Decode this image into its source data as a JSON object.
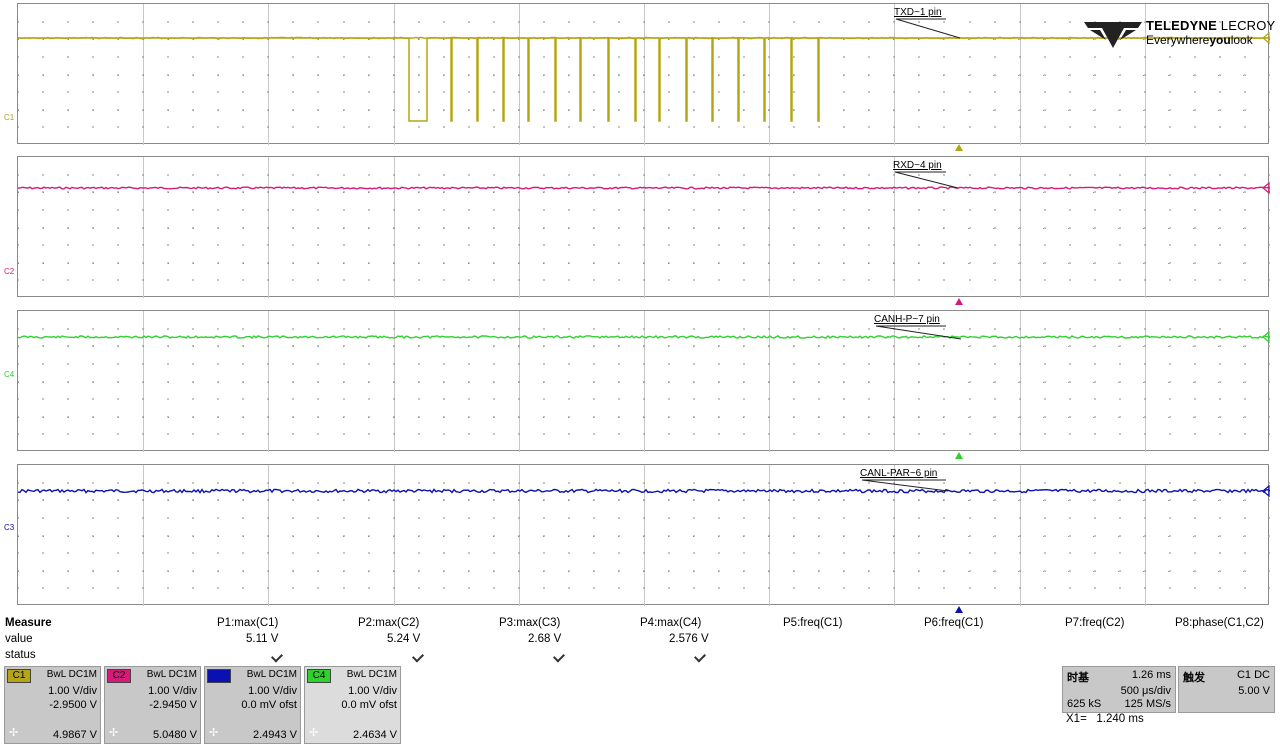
{
  "brand": {
    "name_bold": "TELEDYNE",
    "name_light": "LECROY",
    "tagline_a": "Everywhere",
    "tagline_b": "you",
    "tagline_c": "look"
  },
  "panels": [
    {
      "id": "C1",
      "label": "C1",
      "color": "#b5a515",
      "annotation": "TXD~1 pin"
    },
    {
      "id": "C2",
      "label": "C2",
      "color": "#d6197a",
      "annotation": "RXD~4 pin"
    },
    {
      "id": "C4",
      "label": "C4",
      "color": "#2fd12f",
      "annotation": "CANH-P~7 pin"
    },
    {
      "id": "C3",
      "label": "C3",
      "color": "#0b10b0",
      "annotation": "CANL-PAR~6 pin"
    }
  ],
  "measure": {
    "title": "Measure",
    "value_label": "value",
    "status_label": "status",
    "params": [
      {
        "name": "P1:max(C1)",
        "value": "5.11 V",
        "ok": true
      },
      {
        "name": "P2:max(C2)",
        "value": "5.24 V",
        "ok": true
      },
      {
        "name": "P3:max(C3)",
        "value": "2.68 V",
        "ok": true
      },
      {
        "name": "P4:max(C4)",
        "value": "2.576 V",
        "ok": true
      },
      {
        "name": "P5:freq(C1)",
        "value": "",
        "ok": false
      },
      {
        "name": "P6:freq(C1)",
        "value": "",
        "ok": false
      },
      {
        "name": "P7:freq(C2)",
        "value": "",
        "ok": false
      },
      {
        "name": "P8:phase(C1,C2)",
        "value": "",
        "ok": false
      }
    ]
  },
  "channels": [
    {
      "tag": "C1",
      "coupling": "BwL DC1M",
      "vdiv": "1.00 V/div",
      "offset": "-2.9500 V",
      "readout": "4.9867 V",
      "color": "#b5a515"
    },
    {
      "tag": "C2",
      "coupling": "BwL DC1M",
      "vdiv": "1.00 V/div",
      "offset": "-2.9450 V",
      "readout": "5.0480 V",
      "color": "#d6197a"
    },
    {
      "tag": "C3",
      "coupling": "BwL DC1M",
      "vdiv": "1.00 V/div",
      "offset": "0.0 mV ofst",
      "readout": "2.4943 V",
      "color": "#0b10b0"
    },
    {
      "tag": "C4",
      "coupling": "BwL DC1M",
      "vdiv": "1.00 V/div",
      "offset": "0.0 mV ofst",
      "readout": "2.4634 V",
      "color": "#2fd12f"
    }
  ],
  "timebase": {
    "label": "时基",
    "delay": "1.26 ms",
    "tdiv": "500 μs/div",
    "samples": "625 kS",
    "rate": "125 MS/s"
  },
  "trigger": {
    "label": "触发",
    "source": "C1 DC",
    "level": "5.00 V"
  },
  "cursor": {
    "label": "X1=",
    "value": "1.240 ms"
  }
}
